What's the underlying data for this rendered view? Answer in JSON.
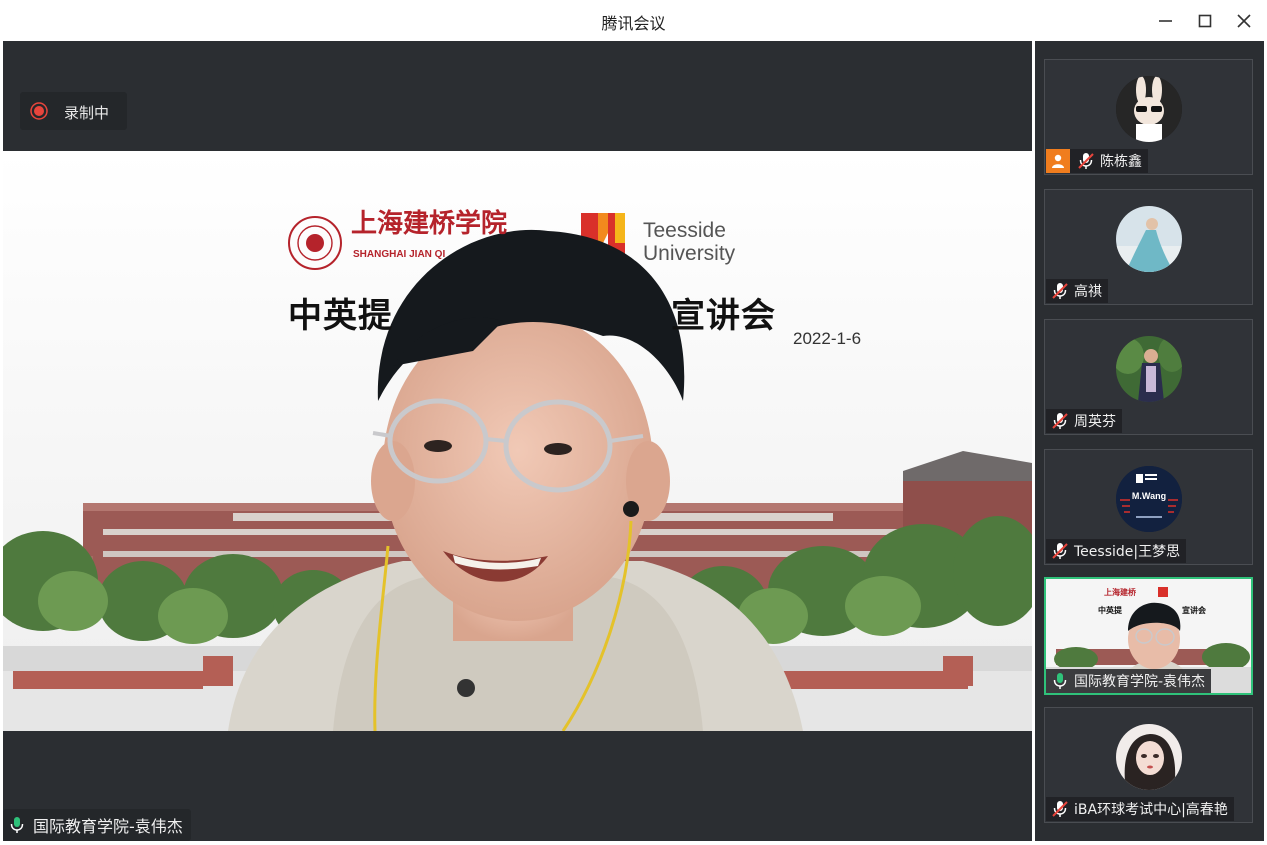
{
  "window": {
    "title": "腾讯会议"
  },
  "recording": {
    "label": "录制中"
  },
  "slide": {
    "school_cn": "上海建桥学院",
    "school_en": "SHANGHAI JIAN QI",
    "partner_line1": "Teesside",
    "partner_line2": "University",
    "title": "中英提",
    "title_right": "宣讲会",
    "date": "2022-1-6"
  },
  "active_speaker": {
    "name": "国际教育学院-袁伟杰"
  },
  "participants": [
    {
      "name": "陈栋鑫",
      "muted": true,
      "host": true
    },
    {
      "name": "高祺",
      "muted": true,
      "host": false
    },
    {
      "name": "周英芬",
      "muted": true,
      "host": false
    },
    {
      "name": "Teesside|王梦思",
      "muted": true,
      "host": false,
      "avatar_text": "M.Wang"
    },
    {
      "name": "国际教育学院-袁伟杰",
      "muted": false,
      "host": false,
      "active": true
    },
    {
      "name": "iBA环球考试中心|高春艳",
      "muted": true,
      "host": false
    }
  ],
  "colors": {
    "stage_bg": "#2b2e32",
    "accent_active": "#2fc27a",
    "mic_on": "#2fc27a",
    "mic_muted": "#e8453c",
    "rec": "#e8453c",
    "host_badge": "#f07d1e",
    "brand_red": "#b5232b"
  }
}
